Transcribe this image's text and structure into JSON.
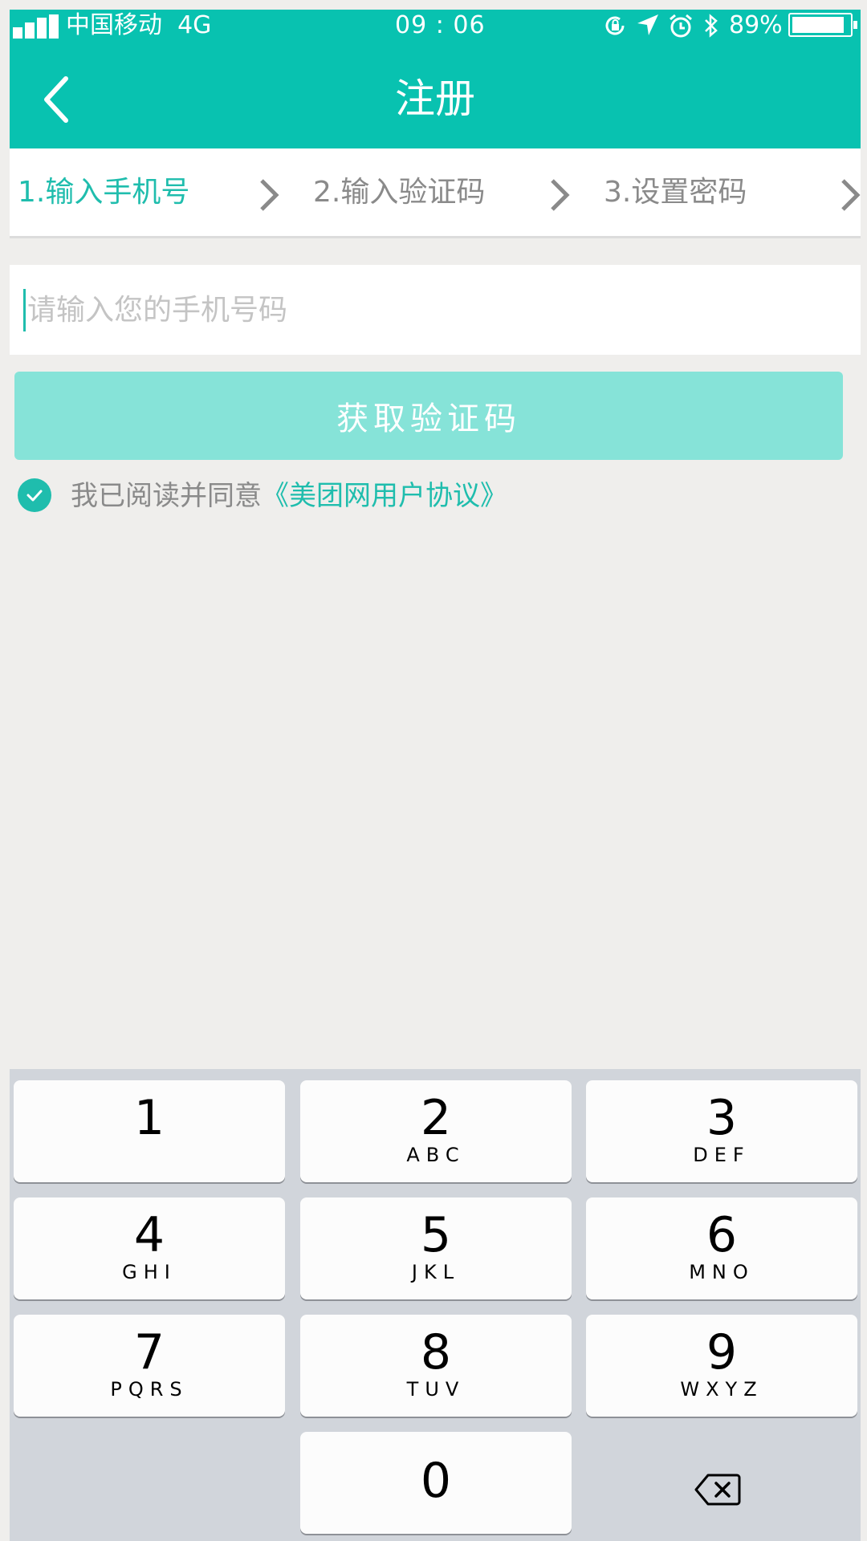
{
  "status_bar": {
    "carrier": "中国移动",
    "network": "4G",
    "time": "09 : 06",
    "battery_percent": "89%",
    "battery_level": 0.89,
    "icons": [
      "rotation-lock-icon",
      "location-arrow-icon",
      "alarm-icon",
      "bluetooth-icon"
    ]
  },
  "nav": {
    "back_icon": "chevron-left-icon",
    "title": "注册"
  },
  "steps": [
    {
      "label": "1.输入手机号",
      "active": true
    },
    {
      "label": "2.输入验证码",
      "active": false
    },
    {
      "label": "3.设置密码",
      "active": false
    }
  ],
  "phone_field": {
    "value": "",
    "placeholder": "请输入您的手机号码"
  },
  "get_code_button": {
    "label": "获取验证码"
  },
  "agreement": {
    "checked": true,
    "prefix": "我已阅读并同意",
    "link": "《美团网用户协议》"
  },
  "keypad": {
    "keys": [
      {
        "num": "1",
        "letters": ""
      },
      {
        "num": "2",
        "letters": "ABC"
      },
      {
        "num": "3",
        "letters": "DEF"
      },
      {
        "num": "4",
        "letters": "GHI"
      },
      {
        "num": "5",
        "letters": "JKL"
      },
      {
        "num": "6",
        "letters": "MNO"
      },
      {
        "num": "7",
        "letters": "PQRS"
      },
      {
        "num": "8",
        "letters": "TUV"
      },
      {
        "num": "9",
        "letters": "WXYZ"
      }
    ],
    "zero": "0",
    "delete_icon": "backspace-icon"
  },
  "colors": {
    "brand": "#08c2b0",
    "accent": "#1fbdad",
    "button_disabled": "#86e3d8",
    "background": "#efeeec",
    "keyboard": "#d1d5db"
  }
}
